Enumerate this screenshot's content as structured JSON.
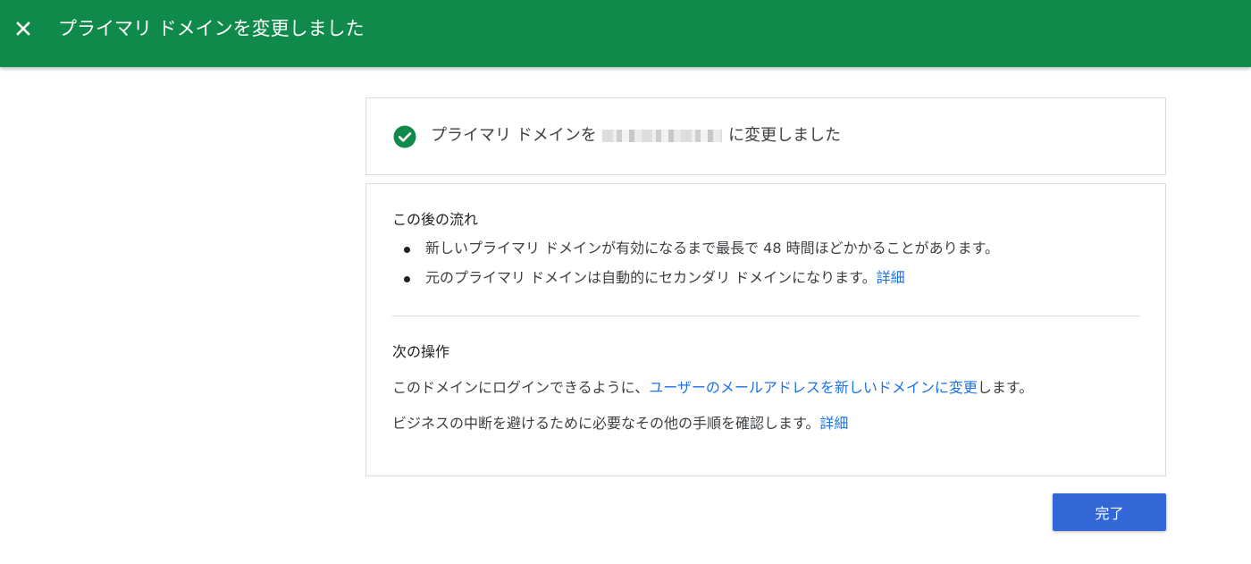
{
  "header": {
    "title": "プライマリ ドメインを変更しました",
    "close_icon": "close-icon"
  },
  "success_card": {
    "icon": "check-circle-icon",
    "icon_color": "#0f8a4b",
    "text_before": "プライマリ ドメインを ",
    "text_after": " に変更しました"
  },
  "next_steps": {
    "heading": "この後の流れ",
    "items": [
      {
        "text": "新しいプライマリ ドメインが有効になるまで最長で 48 時間ほどかかることがあります。",
        "link": ""
      },
      {
        "text": "元のプライマリ ドメインは自動的にセカンダリ ドメインになります。",
        "link": "詳細"
      }
    ]
  },
  "actions": {
    "heading": "次の操作",
    "line1": {
      "before": "このドメインにログインできるように、",
      "link": "ユーザーのメールアドレスを新しいドメインに変更",
      "after": "します。"
    },
    "line2": {
      "before": "ビジネスの中断を避けるために必要なその他の手順を確認します。",
      "link": "詳細"
    }
  },
  "footer": {
    "done_label": "完了"
  },
  "colors": {
    "header_bg": "#0f8a4b",
    "link": "#1a73e8",
    "primary_button": "#3367d6"
  }
}
